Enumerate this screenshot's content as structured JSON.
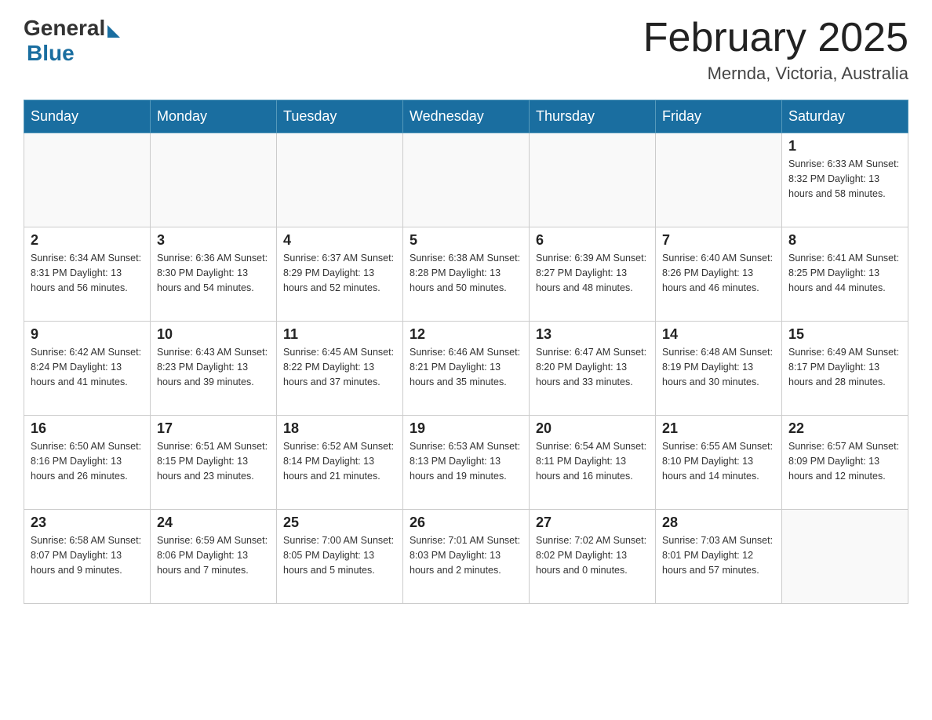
{
  "header": {
    "logo_general": "General",
    "logo_blue": "Blue",
    "title": "February 2025",
    "subtitle": "Mernda, Victoria, Australia"
  },
  "weekdays": [
    "Sunday",
    "Monday",
    "Tuesday",
    "Wednesday",
    "Thursday",
    "Friday",
    "Saturday"
  ],
  "weeks": [
    [
      {
        "day": "",
        "info": ""
      },
      {
        "day": "",
        "info": ""
      },
      {
        "day": "",
        "info": ""
      },
      {
        "day": "",
        "info": ""
      },
      {
        "day": "",
        "info": ""
      },
      {
        "day": "",
        "info": ""
      },
      {
        "day": "1",
        "info": "Sunrise: 6:33 AM\nSunset: 8:32 PM\nDaylight: 13 hours\nand 58 minutes."
      }
    ],
    [
      {
        "day": "2",
        "info": "Sunrise: 6:34 AM\nSunset: 8:31 PM\nDaylight: 13 hours\nand 56 minutes."
      },
      {
        "day": "3",
        "info": "Sunrise: 6:36 AM\nSunset: 8:30 PM\nDaylight: 13 hours\nand 54 minutes."
      },
      {
        "day": "4",
        "info": "Sunrise: 6:37 AM\nSunset: 8:29 PM\nDaylight: 13 hours\nand 52 minutes."
      },
      {
        "day": "5",
        "info": "Sunrise: 6:38 AM\nSunset: 8:28 PM\nDaylight: 13 hours\nand 50 minutes."
      },
      {
        "day": "6",
        "info": "Sunrise: 6:39 AM\nSunset: 8:27 PM\nDaylight: 13 hours\nand 48 minutes."
      },
      {
        "day": "7",
        "info": "Sunrise: 6:40 AM\nSunset: 8:26 PM\nDaylight: 13 hours\nand 46 minutes."
      },
      {
        "day": "8",
        "info": "Sunrise: 6:41 AM\nSunset: 8:25 PM\nDaylight: 13 hours\nand 44 minutes."
      }
    ],
    [
      {
        "day": "9",
        "info": "Sunrise: 6:42 AM\nSunset: 8:24 PM\nDaylight: 13 hours\nand 41 minutes."
      },
      {
        "day": "10",
        "info": "Sunrise: 6:43 AM\nSunset: 8:23 PM\nDaylight: 13 hours\nand 39 minutes."
      },
      {
        "day": "11",
        "info": "Sunrise: 6:45 AM\nSunset: 8:22 PM\nDaylight: 13 hours\nand 37 minutes."
      },
      {
        "day": "12",
        "info": "Sunrise: 6:46 AM\nSunset: 8:21 PM\nDaylight: 13 hours\nand 35 minutes."
      },
      {
        "day": "13",
        "info": "Sunrise: 6:47 AM\nSunset: 8:20 PM\nDaylight: 13 hours\nand 33 minutes."
      },
      {
        "day": "14",
        "info": "Sunrise: 6:48 AM\nSunset: 8:19 PM\nDaylight: 13 hours\nand 30 minutes."
      },
      {
        "day": "15",
        "info": "Sunrise: 6:49 AM\nSunset: 8:17 PM\nDaylight: 13 hours\nand 28 minutes."
      }
    ],
    [
      {
        "day": "16",
        "info": "Sunrise: 6:50 AM\nSunset: 8:16 PM\nDaylight: 13 hours\nand 26 minutes."
      },
      {
        "day": "17",
        "info": "Sunrise: 6:51 AM\nSunset: 8:15 PM\nDaylight: 13 hours\nand 23 minutes."
      },
      {
        "day": "18",
        "info": "Sunrise: 6:52 AM\nSunset: 8:14 PM\nDaylight: 13 hours\nand 21 minutes."
      },
      {
        "day": "19",
        "info": "Sunrise: 6:53 AM\nSunset: 8:13 PM\nDaylight: 13 hours\nand 19 minutes."
      },
      {
        "day": "20",
        "info": "Sunrise: 6:54 AM\nSunset: 8:11 PM\nDaylight: 13 hours\nand 16 minutes."
      },
      {
        "day": "21",
        "info": "Sunrise: 6:55 AM\nSunset: 8:10 PM\nDaylight: 13 hours\nand 14 minutes."
      },
      {
        "day": "22",
        "info": "Sunrise: 6:57 AM\nSunset: 8:09 PM\nDaylight: 13 hours\nand 12 minutes."
      }
    ],
    [
      {
        "day": "23",
        "info": "Sunrise: 6:58 AM\nSunset: 8:07 PM\nDaylight: 13 hours\nand 9 minutes."
      },
      {
        "day": "24",
        "info": "Sunrise: 6:59 AM\nSunset: 8:06 PM\nDaylight: 13 hours\nand 7 minutes."
      },
      {
        "day": "25",
        "info": "Sunrise: 7:00 AM\nSunset: 8:05 PM\nDaylight: 13 hours\nand 5 minutes."
      },
      {
        "day": "26",
        "info": "Sunrise: 7:01 AM\nSunset: 8:03 PM\nDaylight: 13 hours\nand 2 minutes."
      },
      {
        "day": "27",
        "info": "Sunrise: 7:02 AM\nSunset: 8:02 PM\nDaylight: 13 hours\nand 0 minutes."
      },
      {
        "day": "28",
        "info": "Sunrise: 7:03 AM\nSunset: 8:01 PM\nDaylight: 12 hours\nand 57 minutes."
      },
      {
        "day": "",
        "info": ""
      }
    ]
  ]
}
